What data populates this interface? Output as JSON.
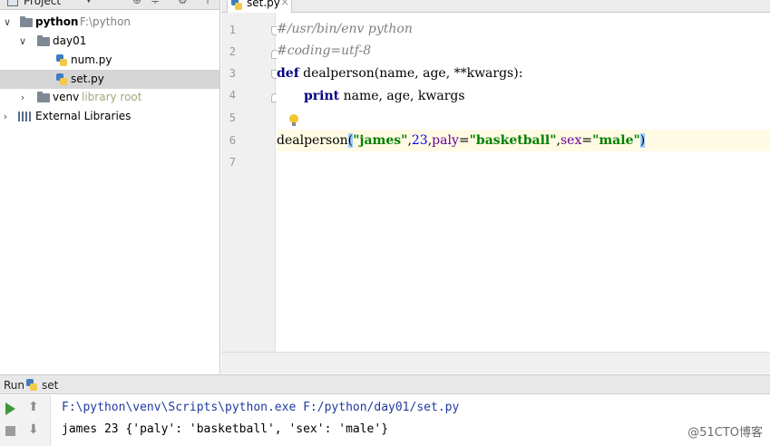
{
  "project": {
    "title": "Project",
    "tree": [
      {
        "label": "python",
        "path": "F:\\python"
      },
      {
        "label": "day01"
      },
      {
        "label": "num.py"
      },
      {
        "label": "set.py"
      },
      {
        "label": "venv",
        "note": "library root"
      },
      {
        "label": "External Libraries"
      }
    ]
  },
  "editor": {
    "tab": "set.py",
    "line_numbers": [
      "1",
      "2",
      "3",
      "4",
      "5",
      "6",
      "7"
    ],
    "code": {
      "l1": "#/usr/bin/env python",
      "l2": "#coding=utf-8",
      "l3_kw": "def",
      "l3_rest": " dealperson(name, age, **kwargs):",
      "l4_kw": "print",
      "l4_rest": " name, age, kwargs",
      "l6_func": "dealperson",
      "l6_open": "(",
      "l6_s1": "\"james\"",
      "l6_c1": ",",
      "l6_num": "23",
      "l6_c2": ",",
      "l6_k1": "paly",
      "l6_eq1": "=",
      "l6_s2": "\"basketball\"",
      "l6_c3": ",",
      "l6_k2": "sex",
      "l6_eq2": "=",
      "l6_s3": "\"male\"",
      "l6_close": ")"
    }
  },
  "run": {
    "label": "Run",
    "config": "set",
    "command": "F:\\python\\venv\\Scripts\\python.exe F:/python/day01/set.py",
    "output": "james 23 {'paly': 'basketball', 'sex': 'male'}",
    "watermark": "@51CTO博客"
  }
}
